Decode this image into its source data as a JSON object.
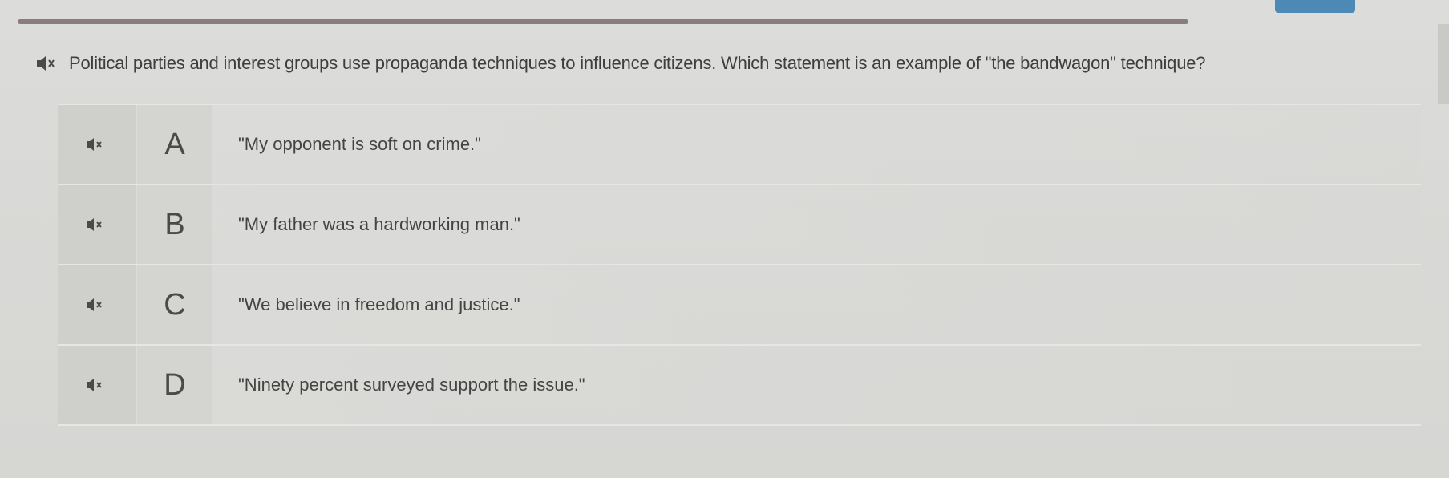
{
  "question": {
    "audio_icon": "speaker-icon",
    "text": "Political parties and interest groups use propaganda techniques to influence citizens. Which statement is an example of \"the bandwagon\" technique?"
  },
  "options": [
    {
      "letter": "A",
      "text": "\"My opponent is soft on crime.\"",
      "audio_icon": "speaker-icon"
    },
    {
      "letter": "B",
      "text": "\"My father was a hardworking man.\"",
      "audio_icon": "speaker-icon"
    },
    {
      "letter": "C",
      "text": "\"We believe in freedom and justice.\"",
      "audio_icon": "speaker-icon"
    },
    {
      "letter": "D",
      "text": "\"Ninety percent surveyed support the issue.\"",
      "audio_icon": "speaker-icon"
    }
  ],
  "colors": {
    "background": "#d9d9d7",
    "progress_bar": "#7b6c72",
    "accent": "#4c8ab5",
    "option_cell": "#cfcfcc"
  }
}
